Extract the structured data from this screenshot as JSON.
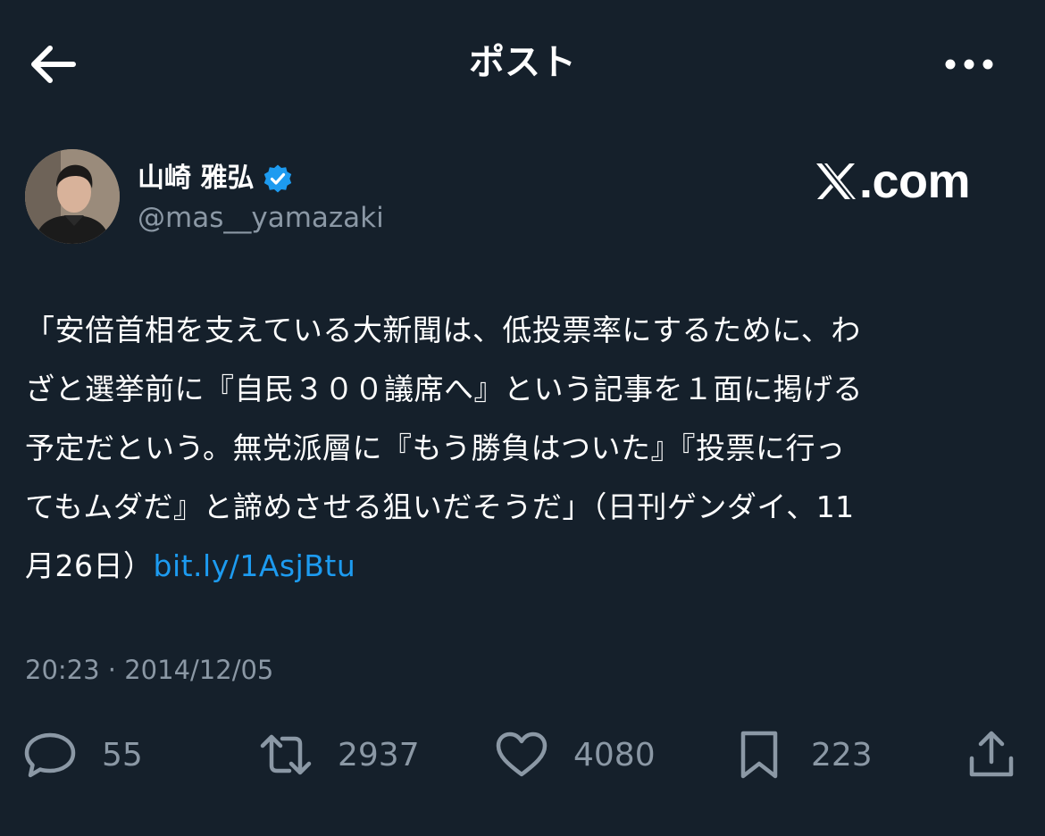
{
  "header": {
    "title": "ポスト",
    "back_icon": "arrow-left-icon",
    "more_icon": "more-horizontal-icon"
  },
  "author": {
    "name": "山崎 雅弘",
    "handle": "@mas__yamazaki",
    "verified_icon": "verified-badge-icon",
    "avatar": "avatar-photo"
  },
  "watermark": {
    "x_glyph": "𝕏",
    "text": ".com"
  },
  "tweet": {
    "lines": [
      "「安倍首相を支えている大新聞は、低投票率にするために、わ",
      "ざと選挙前に『自民３００議席へ』という記事を１面に掲げる",
      "予定だという。無党派層に『もう勝負はついた』『投票に行っ",
      "てもムダだ』と諦めさせる狙いだそうだ」（日刊ゲンダイ、11",
      "月26日）"
    ],
    "link": "bit.ly/1AsjBtu"
  },
  "timestamp": "20:23 · 2014/12/05",
  "actions": {
    "reply": {
      "icon": "reply-icon",
      "count": "55"
    },
    "retweet": {
      "icon": "retweet-icon",
      "count": "2937"
    },
    "like": {
      "icon": "heart-icon",
      "count": "4080"
    },
    "bookmark": {
      "icon": "bookmark-icon",
      "count": "223"
    },
    "share": {
      "icon": "share-icon"
    }
  },
  "colors": {
    "background": "#15202b",
    "text": "#ffffff",
    "secondary": "#8b98a5",
    "link": "#1d9bf0",
    "verified": "#1d9bf0"
  }
}
